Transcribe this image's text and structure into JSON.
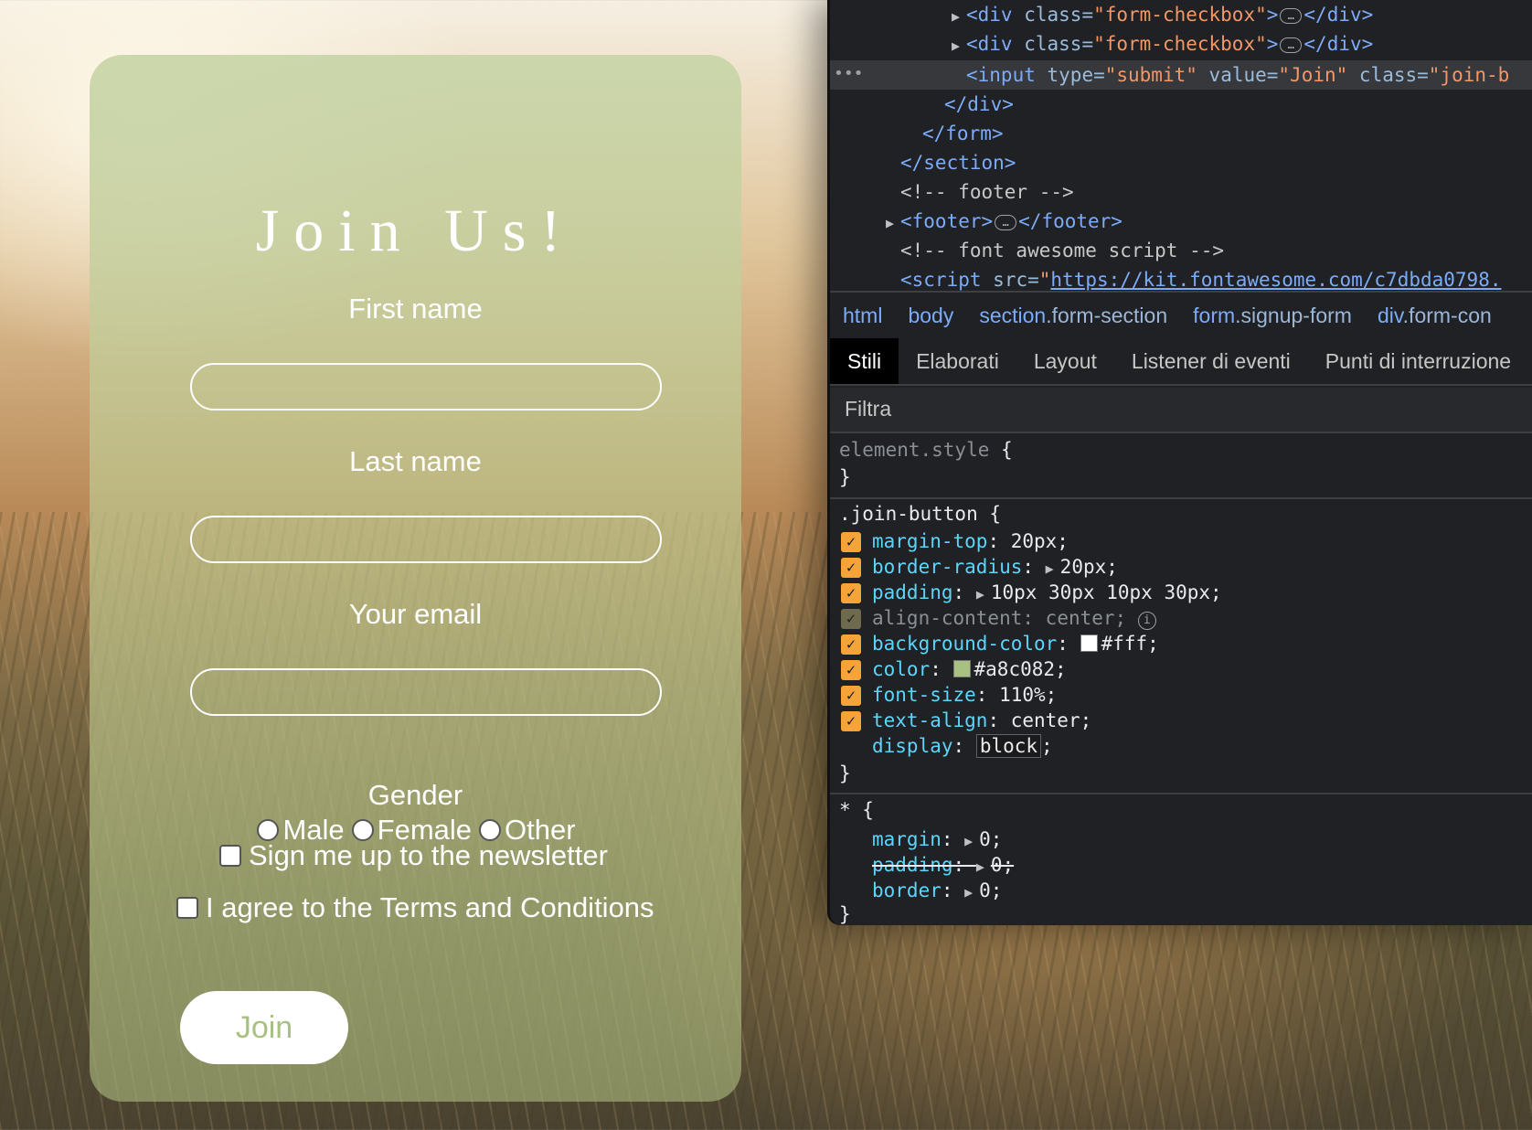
{
  "form": {
    "title": "Join Us!",
    "first_name_label": "First name",
    "last_name_label": "Last name",
    "email_label": "Your email",
    "gender_label": "Gender",
    "gender_options": [
      "Male",
      "Female",
      "Other"
    ],
    "newsletter_label": "Sign me up to the newsletter",
    "terms_label": "I agree to the Terms and Conditions",
    "submit_label": "Join"
  },
  "devtools": {
    "elements": {
      "line1": {
        "tag_open": "<div",
        "attr": "class=",
        "value": "\"form-checkbox\"",
        "close_start": ">",
        "close": "</div>"
      },
      "line2": {
        "tag_open": "<div",
        "attr": "class=",
        "value": "\"form-checkbox\"",
        "close_start": ">",
        "close": "</div>"
      },
      "line3": {
        "tag_open": "<input",
        "attr1": "type=",
        "val1": "\"submit\"",
        "attr2": "value=",
        "val2": "\"Join\"",
        "attr3": "class=",
        "val3": "\"join-b"
      },
      "line4": "</div>",
      "line5": "</form>",
      "line6": "</section>",
      "line7": "<!-- footer -->",
      "line8": {
        "open": "<footer>",
        "close": "</footer>"
      },
      "line9": "<!-- font awesome script -->",
      "line10": {
        "open": "<script",
        "attr": "src=",
        "quote": "\"",
        "url": "https://kit.fontawesome.com/c7dbda0798."
      },
      "ellipsis": "…",
      "row_menu": "•••"
    },
    "breadcrumb": [
      {
        "tag": "html",
        "cls": ""
      },
      {
        "tag": "body",
        "cls": ""
      },
      {
        "tag": "section",
        "cls": ".form-section"
      },
      {
        "tag": "form",
        "cls": ".signup-form"
      },
      {
        "tag": "div",
        "cls": ".form-con"
      }
    ],
    "tabs": [
      "Stili",
      "Elaborati",
      "Layout",
      "Listener di eventi",
      "Punti di interruzione"
    ],
    "filter_placeholder": "Filtra",
    "styles": {
      "element_style": "element.style {",
      "close_brace": "}",
      "join_selector": ".join-button {",
      "rules": [
        {
          "prop": "margin-top",
          "value": "20px;",
          "arrow": false
        },
        {
          "prop": "border-radius",
          "value": "20px;",
          "arrow": true
        },
        {
          "prop": "padding",
          "value": "10px 30px 10px 30px;",
          "arrow": true
        },
        {
          "prop": "align-content",
          "value": "center;",
          "arrow": false,
          "disabled": true
        },
        {
          "prop": "background-color",
          "value": "#fff;",
          "swatch": "#ffffff"
        },
        {
          "prop": "color",
          "value": "#a8c082;",
          "swatch": "#a8c082"
        },
        {
          "prop": "font-size",
          "value": "110%;",
          "arrow": false
        },
        {
          "prop": "text-align",
          "value": "center;",
          "arrow": false
        },
        {
          "prop": "display",
          "value": "block",
          "editing": true
        }
      ],
      "universal_selector": "* {",
      "universal_rules": [
        {
          "prop": "margin",
          "value": "0;"
        },
        {
          "prop": "padding",
          "value": "0;",
          "struck": true
        },
        {
          "prop": "border",
          "value": "0;"
        }
      ]
    }
  },
  "colors": {
    "accent": "#a8c082",
    "checkbox_orange": "#f6a43a"
  }
}
